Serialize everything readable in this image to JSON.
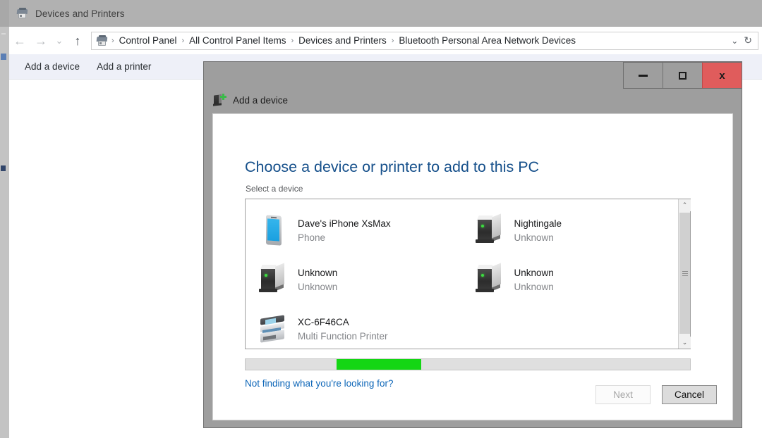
{
  "window": {
    "title": "Devices and Printers",
    "title_icon": "printer-device-icon"
  },
  "navbar": {
    "back_icon": "←",
    "forward_icon": "→",
    "recent_icon": "⌄",
    "up_icon": "↑",
    "breadcrumb_icon": "printer-device-icon",
    "separator": "›",
    "crumbs": [
      "Control Panel",
      "All Control Panel Items",
      "Devices and Printers",
      "Bluetooth Personal Area Network Devices"
    ],
    "dropdown_icon": "⌄",
    "refresh_icon": "↻"
  },
  "command_bar": {
    "items": [
      "Add a device",
      "Add a printer"
    ]
  },
  "dialog": {
    "title": "Add a device",
    "title_icon": "add-device-icon",
    "window_buttons": {
      "minimize": "minimize-icon",
      "maximize": "maximize-icon",
      "close": "x"
    },
    "heading": "Choose a device or printer to add to this PC",
    "subheading": "Select a device",
    "devices": [
      {
        "name": "Dave's iPhone XsMax",
        "type": "Phone",
        "icon": "phone-icon"
      },
      {
        "name": "Nightingale",
        "type": "Unknown",
        "icon": "server-icon"
      },
      {
        "name": "Unknown",
        "type": "Unknown",
        "icon": "server-icon"
      },
      {
        "name": "Unknown",
        "type": "Unknown",
        "icon": "server-icon"
      },
      {
        "name": "XC-6F46CA",
        "type": "Multi Function Printer",
        "icon": "printer-icon"
      }
    ],
    "scrollbar": {
      "up_icon": "⌃",
      "down_icon": "⌄"
    },
    "progress": {
      "style": "marquee",
      "accent_color": "#14d614"
    },
    "help_link": "Not finding what you're looking for?",
    "buttons": {
      "next": {
        "label": "Next",
        "enabled": false
      },
      "cancel": {
        "label": "Cancel",
        "enabled": true
      }
    }
  },
  "colors": {
    "heading_blue": "#16508b",
    "link_blue": "#0d66b8",
    "close_red": "#e05c5c",
    "progress_green": "#14d614",
    "command_bar_bg": "#eef0f8"
  }
}
